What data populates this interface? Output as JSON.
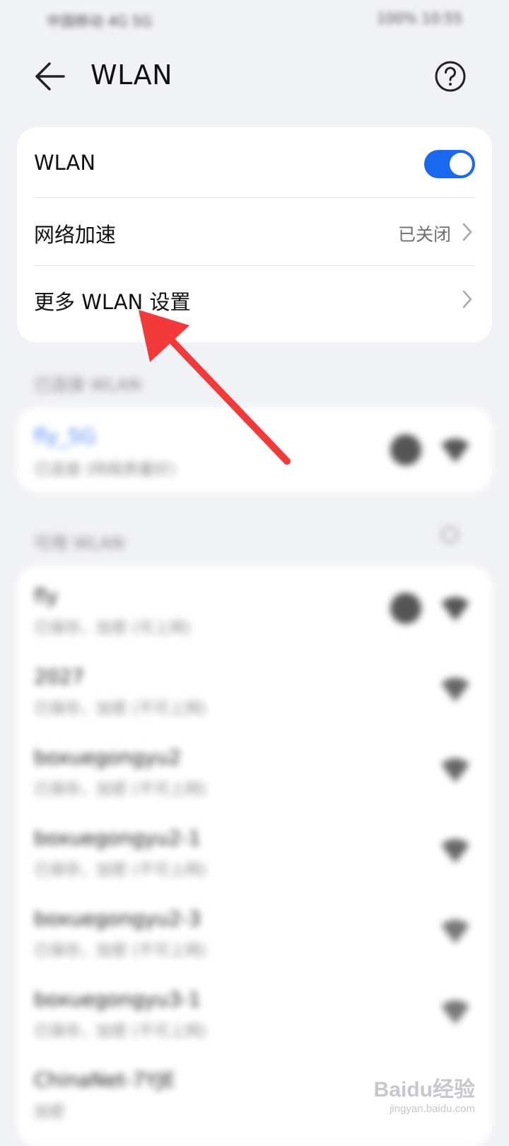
{
  "status_bar": {
    "left": "中国移动 4G 5G",
    "right": "100% 10:55"
  },
  "app_bar": {
    "title": "WLAN"
  },
  "settings": {
    "wlan_label": "WLAN",
    "wlan_enabled": true,
    "acceleration_label": "网络加速",
    "acceleration_value": "已关闭",
    "more_settings_label": "更多 WLAN 设置"
  },
  "connected": {
    "header": "已连接 WLAN",
    "network": {
      "name": "fly_5G",
      "status": "已连接 (网络质量好)"
    }
  },
  "available": {
    "header": "可用 WLAN",
    "networks": [
      {
        "name": "fly",
        "status": "已保存，加密 (可上网)"
      },
      {
        "name": "2027",
        "status": "已保存，加密 (不可上网)"
      },
      {
        "name": "boxuegongyu2",
        "status": "已保存，加密 (不可上网)"
      },
      {
        "name": "boxuegongyu2-1",
        "status": "已保存，加密 (不可上网)"
      },
      {
        "name": "boxuegongyu2-3",
        "status": "已保存，加密 (不可上网)"
      },
      {
        "name": "boxuegongyu3-1",
        "status": "已保存，加密 (不可上网)"
      },
      {
        "name": "ChinaNet-7YJE",
        "status": "加密"
      }
    ]
  },
  "watermark": {
    "main": "Baidu经验",
    "sub": "jingyan.baidu.com"
  },
  "colors": {
    "accent": "#1a67f0",
    "annotation_arrow": "#f23a3a"
  }
}
